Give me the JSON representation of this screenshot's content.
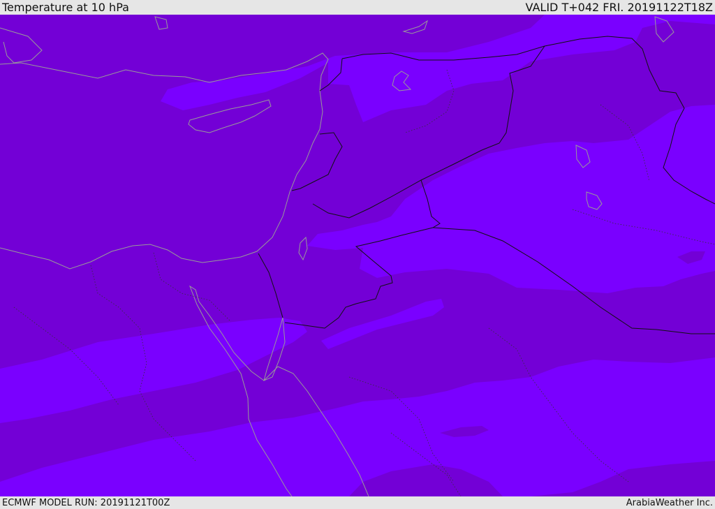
{
  "header": {
    "title": "Temperature at 10 hPa",
    "valid_time": "VALID T+042 FRI. 20191122T18Z"
  },
  "footer": {
    "model_run": "ECMWF MODEL RUN: 20191121T00Z",
    "credit": "ArabiaWeather Inc."
  },
  "colors": {
    "field_dark": "#7300d6",
    "field_light": "#7a00ff",
    "coastline": "#9a9a9a",
    "borders": "#111111"
  }
}
